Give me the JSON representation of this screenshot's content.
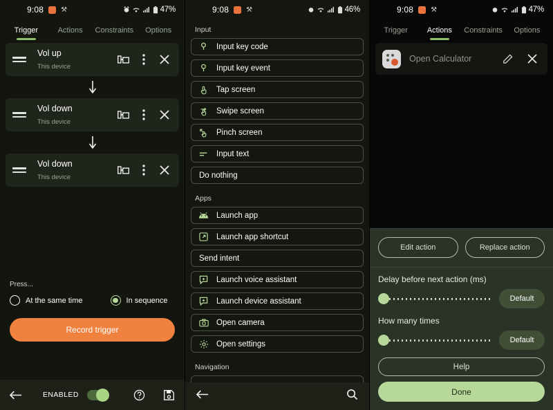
{
  "status_bar": {
    "time": "9:08",
    "battery_p1": "47%",
    "battery_p2": "46%",
    "battery_p3": "47%",
    "icons": [
      "alarm-icon",
      "wifi-icon",
      "signal-icon",
      "battery-icon"
    ]
  },
  "tabs": [
    "Trigger",
    "Actions",
    "Constraints",
    "Options"
  ],
  "panel1": {
    "active_tab": "Trigger",
    "triggers": [
      {
        "title": "Vol up",
        "subtitle": "This device"
      },
      {
        "title": "Vol down",
        "subtitle": "This device"
      },
      {
        "title": "Vol down",
        "subtitle": "This device"
      }
    ],
    "press_label": "Press...",
    "options": [
      {
        "label": "At the same time",
        "selected": false
      },
      {
        "label": "In sequence",
        "selected": true
      }
    ],
    "record_button": "Record trigger",
    "appbar": {
      "enabled_label": "ENABLED",
      "enabled_on": true,
      "back_icon": "back-arrow-icon",
      "help_icon": "help-icon",
      "save_icon": "save-icon"
    }
  },
  "panel2": {
    "sections": [
      {
        "heading": "Input",
        "items": [
          {
            "label": "Input key code",
            "icon": "key-icon"
          },
          {
            "label": "Input key event",
            "icon": "key-icon"
          },
          {
            "label": "Tap screen",
            "icon": "tap-icon"
          },
          {
            "label": "Swipe screen",
            "icon": "swipe-icon"
          },
          {
            "label": "Pinch screen",
            "icon": "pinch-icon"
          },
          {
            "label": "Input text",
            "icon": "text-lines-icon"
          },
          {
            "label": "Do nothing",
            "icon": ""
          }
        ]
      },
      {
        "heading": "Apps",
        "items": [
          {
            "label": "Launch app",
            "icon": "android-icon"
          },
          {
            "label": "Launch app shortcut",
            "icon": "external-link-icon"
          },
          {
            "label": "Send intent",
            "icon": ""
          },
          {
            "label": "Launch voice assistant",
            "icon": "assistant-icon"
          },
          {
            "label": "Launch device assistant",
            "icon": "assistant-icon"
          },
          {
            "label": "Open camera",
            "icon": "camera-icon"
          },
          {
            "label": "Open settings",
            "icon": "gear-icon"
          }
        ]
      },
      {
        "heading": "Navigation",
        "items": []
      }
    ],
    "bottombar": {
      "back_icon": "back-arrow-icon",
      "search_icon": "search-icon"
    }
  },
  "panel3": {
    "active_tab": "Actions",
    "action": {
      "title": "Open Calculator",
      "app_icon": "calculator-app-icon",
      "edit_icon": "pencil-icon",
      "close_icon": "close-icon"
    },
    "sheet": {
      "edit_action": "Edit action",
      "replace_action": "Replace action",
      "delay_label": "Delay before next action (ms)",
      "delay_value": "Default",
      "times_label": "How many times",
      "times_value": "Default",
      "help": "Help",
      "done": "Done"
    }
  },
  "colors": {
    "accent_green": "#b6d99a",
    "accent_orange": "#f0813f",
    "panel_bg": "#13160f",
    "card_bg": "#20251b",
    "sheet_bg": "#2b3327"
  }
}
